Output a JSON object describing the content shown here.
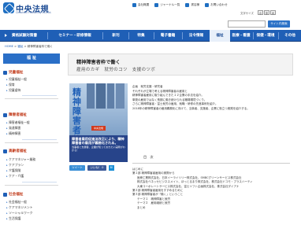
{
  "header": {
    "logo_name": "中央法規",
    "logo_sub": "Chuohoki Publishing Co.,Ltd.",
    "top_links": [
      "会社概要",
      "ジャーナル一覧",
      "書店様",
      "お問い合わせ"
    ],
    "font_size_label": "文字サイズ",
    "font_sizes": [
      "小",
      "中",
      "大"
    ],
    "search_placeholder": "",
    "search_button": "サイト内検索"
  },
  "nav": {
    "items": [
      {
        "label": "資格試験対策書"
      },
      {
        "label": "セミナー・研修情報"
      },
      {
        "label": "新刊"
      },
      {
        "label": "特集"
      },
      {
        "label": "電子書籍"
      },
      {
        "label": "法令情報"
      },
      {
        "label": "福祉"
      },
      {
        "label": "医療・看護"
      },
      {
        "label": "保健・環境"
      },
      {
        "label": "その他"
      }
    ]
  },
  "breadcrumb": {
    "home": "HOME",
    "sep1": ">",
    "cat": "福祉",
    "sep2": ">",
    "current": "精神障害者枠で働く"
  },
  "sidebar": {
    "head": "福 祉",
    "categories": [
      {
        "label": "児童福祉",
        "items": [
          "児童福祉一般",
          "保育",
          "児童虐待"
        ]
      },
      {
        "label": "障害者福祉",
        "items": [
          "障害者福祉一般",
          "発達障害",
          "精神障害"
        ]
      },
      {
        "label": "高齢者福祉",
        "items": [
          "ケアマネジャー業務",
          "ケアプラン",
          "介護保険",
          "ケア・介護"
        ]
      },
      {
        "label": "社会福祉",
        "items": [
          "社会福祉一般",
          "ケアマネジメント",
          "ソーシャルワーク",
          "生活保護"
        ]
      }
    ]
  },
  "main": {
    "title": "精神障害者枠で働く",
    "subtitle": "雇用のカギ　就労のコツ　支援のツボ",
    "book": {
      "title_lines": [
        "精神",
        "障害",
        "者",
        "枠で",
        "働く"
      ],
      "ribbon": "中央法規",
      "blurb_big": "障害者雇用促進法改正により、精神障害者の雇用が義務化される。",
      "blurb": "当事者と支援者、企業が知っておきたい実際がわかる！"
    },
    "share": {
      "tweet": "ツイート",
      "like": "いいね！ 0",
      "hatena": "B!"
    },
    "description": [
      "企画　就労支援・研究者",
      "それぞれが立場で考える精神障害者の雇用と",
      "精神障害者雇用に取り組んできた１２企業の手法を紹介。",
      "単発の雇用ではなく長期に働き続けられる職場環境づくり。",
      "さらに精神障害者・富士就労の雇用、就職・研修の先進事例を紹介。",
      "2018年の精神障害者の雇用義務化に向けて、当事者、支援者、企業に役立つ実践を紹介する。"
    ],
    "toc_label": "目　次",
    "toc": [
      {
        "text": "はじめに",
        "indent": false
      },
      {
        "text": "第１部 精神障害者雇用の実際から",
        "indent": false
      },
      {
        "text": "医療工業株式会社、日本イーライリリー株式会社、SMBCグリーンサービス株式会社",
        "indent": true
      },
      {
        "text": "株式会社ベネッセビジネスメイト、ほっとるまり株式会社、株式会社ドコモ・プラスハーティ",
        "indent": true
      },
      {
        "text": "大東コーポレートサービス株式会社、富士ソフト企画株式会社、株式会社ダイアナ",
        "indent": true
      },
      {
        "text": "第２部 精神障害者雇用をすすめるために",
        "indent": false
      },
      {
        "text": "第３部 精神障害者が「働く」ということ",
        "indent": false
      },
      {
        "text": "テーマ１　精神障害と就労",
        "indent": true
      },
      {
        "text": "テーマ２　雇用継続と就労",
        "indent": true
      },
      {
        "text": "まとめ",
        "indent": true
      }
    ]
  },
  "colors": {
    "brand": "#1f5fb6",
    "category": "#c23d1d",
    "book_blue": "#27448a",
    "book_accent": "#d23a1d"
  }
}
